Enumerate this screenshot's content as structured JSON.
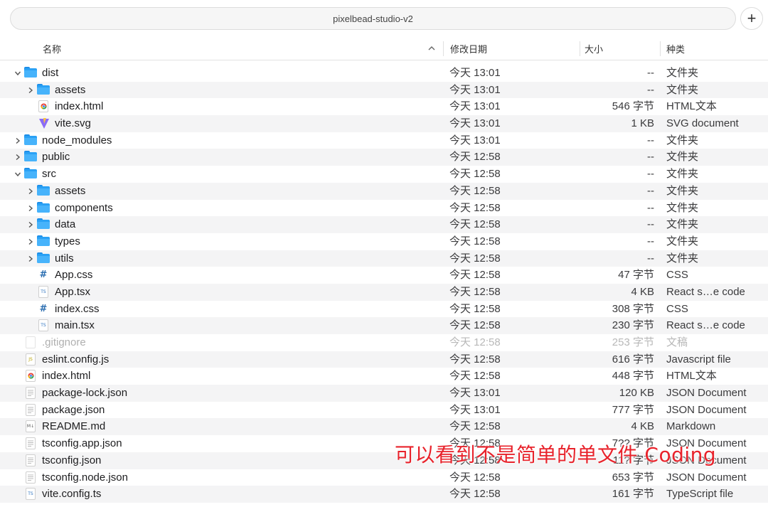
{
  "window": {
    "title": "pixelbead-studio-v2",
    "add_label": "+"
  },
  "columns": {
    "name": "名称",
    "date": "修改日期",
    "size": "大小",
    "kind": "种类"
  },
  "rows": [
    {
      "name": "dist",
      "date": "今天 13:01",
      "size": "--",
      "kind": "文件夹",
      "depth": 0,
      "type": "folder",
      "disclosure": "open"
    },
    {
      "name": "assets",
      "date": "今天 13:01",
      "size": "--",
      "kind": "文件夹",
      "depth": 1,
      "type": "folder",
      "disclosure": "closed"
    },
    {
      "name": "index.html",
      "date": "今天 13:01",
      "size": "546 字节",
      "kind": "HTML文本",
      "depth": 1,
      "type": "html"
    },
    {
      "name": "vite.svg",
      "date": "今天 13:01",
      "size": "1 KB",
      "kind": "SVG document",
      "depth": 1,
      "type": "vite"
    },
    {
      "name": "node_modules",
      "date": "今天 13:01",
      "size": "--",
      "kind": "文件夹",
      "depth": 0,
      "type": "folder",
      "disclosure": "closed"
    },
    {
      "name": "public",
      "date": "今天 12:58",
      "size": "--",
      "kind": "文件夹",
      "depth": 0,
      "type": "folder",
      "disclosure": "closed"
    },
    {
      "name": "src",
      "date": "今天 12:58",
      "size": "--",
      "kind": "文件夹",
      "depth": 0,
      "type": "folder",
      "disclosure": "open"
    },
    {
      "name": "assets",
      "date": "今天 12:58",
      "size": "--",
      "kind": "文件夹",
      "depth": 1,
      "type": "folder",
      "disclosure": "closed"
    },
    {
      "name": "components",
      "date": "今天 12:58",
      "size": "--",
      "kind": "文件夹",
      "depth": 1,
      "type": "folder",
      "disclosure": "closed"
    },
    {
      "name": "data",
      "date": "今天 12:58",
      "size": "--",
      "kind": "文件夹",
      "depth": 1,
      "type": "folder",
      "disclosure": "closed"
    },
    {
      "name": "types",
      "date": "今天 12:58",
      "size": "--",
      "kind": "文件夹",
      "depth": 1,
      "type": "folder",
      "disclosure": "closed"
    },
    {
      "name": "utils",
      "date": "今天 12:58",
      "size": "--",
      "kind": "文件夹",
      "depth": 1,
      "type": "folder",
      "disclosure": "closed"
    },
    {
      "name": "App.css",
      "date": "今天 12:58",
      "size": "47 字节",
      "kind": "CSS",
      "depth": 1,
      "type": "css"
    },
    {
      "name": "App.tsx",
      "date": "今天 12:58",
      "size": "4 KB",
      "kind": "React s…e code",
      "depth": 1,
      "type": "ts"
    },
    {
      "name": "index.css",
      "date": "今天 12:58",
      "size": "308 字节",
      "kind": "CSS",
      "depth": 1,
      "type": "css"
    },
    {
      "name": "main.tsx",
      "date": "今天 12:58",
      "size": "230 字节",
      "kind": "React s…e code",
      "depth": 1,
      "type": "ts"
    },
    {
      "name": ".gitignore",
      "date": "今天 12:58",
      "size": "253 字节",
      "kind": "文稿",
      "depth": 0,
      "type": "blank",
      "dim": true
    },
    {
      "name": "eslint.config.js",
      "date": "今天 12:58",
      "size": "616 字节",
      "kind": "Javascript file",
      "depth": 0,
      "type": "js"
    },
    {
      "name": "index.html",
      "date": "今天 12:58",
      "size": "448 字节",
      "kind": "HTML文本",
      "depth": 0,
      "type": "html"
    },
    {
      "name": "package-lock.json",
      "date": "今天 13:01",
      "size": "120 KB",
      "kind": "JSON Document",
      "depth": 0,
      "type": "json"
    },
    {
      "name": "package.json",
      "date": "今天 13:01",
      "size": "777 字节",
      "kind": "JSON Document",
      "depth": 0,
      "type": "json"
    },
    {
      "name": "README.md",
      "date": "今天 12:58",
      "size": "4 KB",
      "kind": "Markdown",
      "depth": 0,
      "type": "md"
    },
    {
      "name": "tsconfig.app.json",
      "date": "今天 12:58",
      "size": "7?? 字节",
      "kind": "JSON Document",
      "depth": 0,
      "type": "json"
    },
    {
      "name": "tsconfig.json",
      "date": "今天 12:58",
      "size": "11? 字节",
      "kind": "JSON Document",
      "depth": 0,
      "type": "json"
    },
    {
      "name": "tsconfig.node.json",
      "date": "今天 12:58",
      "size": "653 字节",
      "kind": "JSON Document",
      "depth": 0,
      "type": "json"
    },
    {
      "name": "vite.config.ts",
      "date": "今天 12:58",
      "size": "161 字节",
      "kind": "TypeScript file",
      "depth": 0,
      "type": "tsfile"
    }
  ],
  "icon_labels": {
    "css": "#",
    "ts": "TS",
    "js": "JS",
    "md": "M↓"
  },
  "caption": "可以看到不是简单的单文件 Coding",
  "colors": {
    "folder": "#2aa1f5",
    "caption": "#e8222b",
    "row_alt": "#f4f4f5"
  }
}
